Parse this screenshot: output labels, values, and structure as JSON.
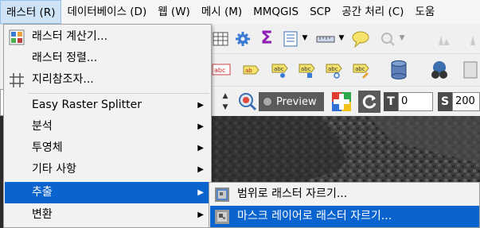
{
  "menubar": [
    {
      "label": "래스터 (R)",
      "active": true
    },
    {
      "label": "데이터베이스 (D)"
    },
    {
      "label": "웹 (W)"
    },
    {
      "label": "메시 (M)"
    },
    {
      "label": "MMQGIS"
    },
    {
      "label": "SCP"
    },
    {
      "label": "공간 처리 (C)"
    },
    {
      "label": "도움"
    }
  ],
  "raster_menu": {
    "items": [
      {
        "label": "래스터 계산기...",
        "icon": "raster-calculator-icon"
      },
      {
        "label": "래스터 정렬...",
        "icon": "none"
      },
      {
        "label": "지리참조자...",
        "icon": "georeferencer-icon"
      },
      {
        "label": "Easy Raster Splitter",
        "submenu": true
      },
      {
        "label": "분석",
        "submenu": true
      },
      {
        "label": "투영체",
        "submenu": true
      },
      {
        "label": "기타 사항",
        "submenu": true
      },
      {
        "label": "추출",
        "submenu": true,
        "highlighted": true
      },
      {
        "label": "변환",
        "submenu": true
      }
    ]
  },
  "extract_submenu": {
    "items": [
      {
        "label": "범위로 래스터 자르기...",
        "icon": "clip-by-extent-icon"
      },
      {
        "label": "마스크 레이어로 래스터 자르기...",
        "icon": "clip-by-mask-icon",
        "highlighted": true
      }
    ]
  },
  "toolbar3": {
    "preview_label": "Preview",
    "t_label": "T",
    "t_value": "0",
    "s_label": "S",
    "s_value": "200"
  },
  "colors": {
    "highlight": "#0a64cf",
    "menubar_active": "#cfe3f7"
  }
}
